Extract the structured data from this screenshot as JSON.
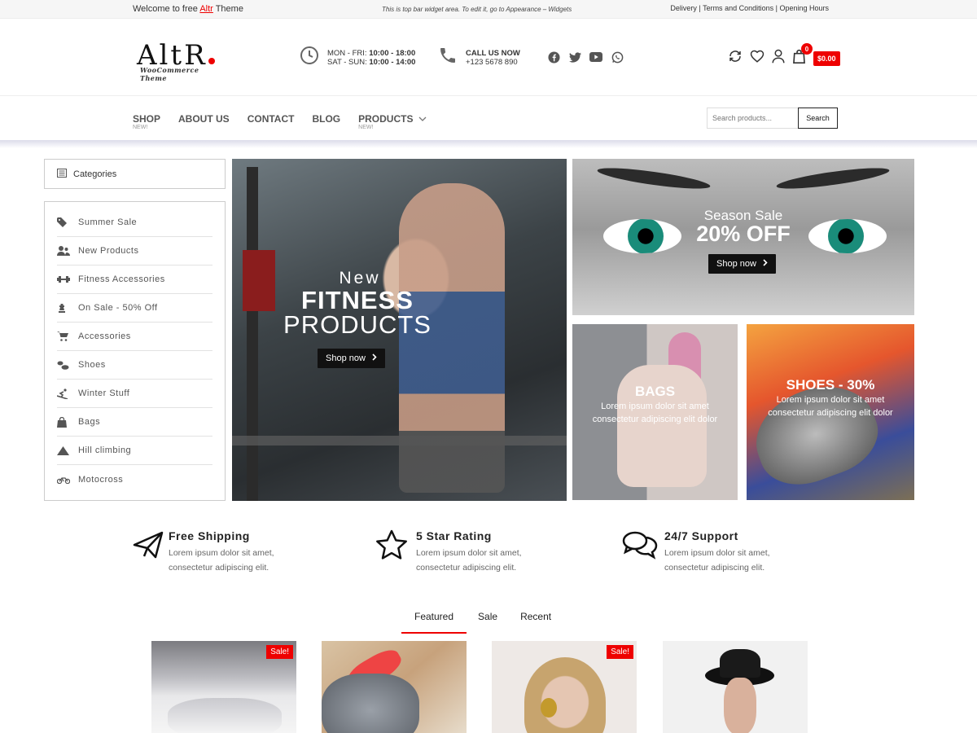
{
  "topbar": {
    "welcome_pre": "Welcome to free",
    "welcome_brand": "Altr",
    "welcome_post": "Theme",
    "widget_text": "This is top bar widget area. To edit it, go to Appearance – Widgets",
    "links": [
      "Delivery",
      "Terms and Conditions",
      "Opening Hours"
    ]
  },
  "header": {
    "logo_main": "AltR",
    "logo_sub": "WooCommerce Theme",
    "hours": {
      "line1_label": "MON - FRI:",
      "line1_time": "10:00 - 18:00",
      "line2_label": "SAT - SUN:",
      "line2_time": "10:00 - 14:00"
    },
    "call": {
      "label": "CALL US NOW",
      "number": "+123 5678 890"
    },
    "social": [
      "facebook-icon",
      "twitter-icon",
      "youtube-icon",
      "whatsapp-icon"
    ],
    "cart_count": "0",
    "cart_total": "$0.00"
  },
  "nav": {
    "items": [
      {
        "label": "SHOP",
        "sub": "NEW!"
      },
      {
        "label": "ABOUT US",
        "sub": ""
      },
      {
        "label": "CONTACT",
        "sub": ""
      },
      {
        "label": "BLOG",
        "sub": ""
      },
      {
        "label": "PRODUCTS",
        "sub": "NEW!"
      }
    ],
    "search_placeholder": "Search products...",
    "search_button": "Search"
  },
  "sidebar": {
    "title": "Categories",
    "items": [
      {
        "label": "Summer Sale",
        "icon": "tag-icon"
      },
      {
        "label": "New Products",
        "icon": "users-icon"
      },
      {
        "label": "Fitness Accessories",
        "icon": "dumbbell-icon"
      },
      {
        "label": "On Sale - 50% Off",
        "icon": "chess-icon"
      },
      {
        "label": "Accessories",
        "icon": "cart-icon"
      },
      {
        "label": "Shoes",
        "icon": "shoe-icon"
      },
      {
        "label": "Winter Stuff",
        "icon": "skier-icon"
      },
      {
        "label": "Bags",
        "icon": "bag-icon"
      },
      {
        "label": "Hill climbing",
        "icon": "mountain-icon"
      },
      {
        "label": "Motocross",
        "icon": "motorcycle-icon"
      }
    ]
  },
  "banners": {
    "main": {
      "l1": "New",
      "l2": "FITNESS",
      "l3": "PRODUCTS",
      "button": "Shop now"
    },
    "eye": {
      "l1": "Season Sale",
      "l2": "20% OFF",
      "button": "Shop now"
    },
    "bags": {
      "title": "BAGS",
      "text": "Lorem ipsum dolor sit amet consectetur adipiscing elit dolor"
    },
    "shoes": {
      "title": "SHOES - 30%",
      "text": "Lorem ipsum dolor sit amet consectetur adipiscing elit dolor"
    }
  },
  "features": [
    {
      "title": "Free Shipping",
      "text": "Lorem ipsum dolor sit amet, consectetur adipiscing elit.",
      "icon": "paper-plane-icon"
    },
    {
      "title": "5 Star Rating",
      "text": "Lorem ipsum dolor sit amet, consectetur adipiscing elit.",
      "icon": "star-icon"
    },
    {
      "title": "24/7 Support",
      "text": "Lorem ipsum dolor sit amet, consectetur adipiscing elit.",
      "icon": "chat-icon"
    }
  ],
  "tabs": [
    "Featured",
    "Sale",
    "Recent"
  ],
  "products": [
    {
      "badge": "Sale!"
    },
    {
      "badge": ""
    },
    {
      "badge": "Sale!"
    },
    {
      "badge": ""
    }
  ],
  "colors": {
    "accent": "#ee0000",
    "dark": "#111111"
  }
}
